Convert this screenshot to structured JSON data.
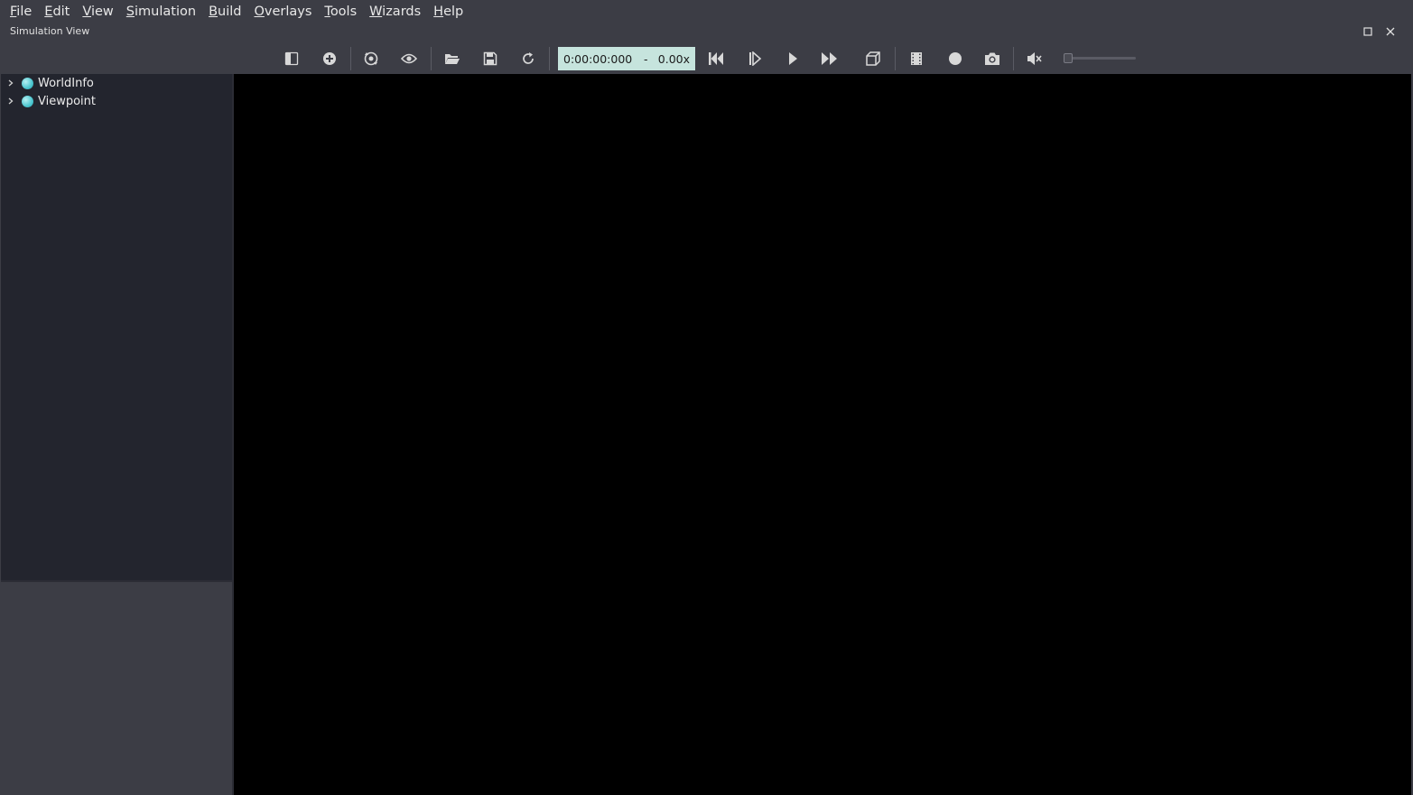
{
  "menubar": {
    "items": [
      {
        "label": "File",
        "mnemonic": "F",
        "rest": "ile"
      },
      {
        "label": "Edit",
        "mnemonic": "E",
        "rest": "dit"
      },
      {
        "label": "View",
        "mnemonic": "V",
        "rest": "iew"
      },
      {
        "label": "Simulation",
        "mnemonic": "S",
        "rest": "imulation"
      },
      {
        "label": "Build",
        "mnemonic": "B",
        "rest": "uild"
      },
      {
        "label": "Overlays",
        "mnemonic": "O",
        "rest": "verlays"
      },
      {
        "label": "Tools",
        "mnemonic": "T",
        "rest": "ools"
      },
      {
        "label": "Wizards",
        "mnemonic": "W",
        "rest": "izards"
      },
      {
        "label": "Help",
        "mnemonic": "H",
        "rest": "elp"
      }
    ]
  },
  "dock": {
    "title": "Simulation View",
    "float_icon": "maximize-icon",
    "close_icon": "close-icon"
  },
  "toolbar": {
    "time": "0:00:00:000",
    "separator": "-",
    "speed": "0.00x",
    "volume_level": 0
  },
  "scene_tree": {
    "items": [
      {
        "label": "WorldInfo"
      },
      {
        "label": "Viewpoint"
      }
    ]
  },
  "colors": {
    "background": "#3c3d45",
    "tree_background": "#23252e",
    "viewport": "#000000",
    "time_box": "#c6e4dd",
    "node_dot": "#4cc6cf"
  }
}
